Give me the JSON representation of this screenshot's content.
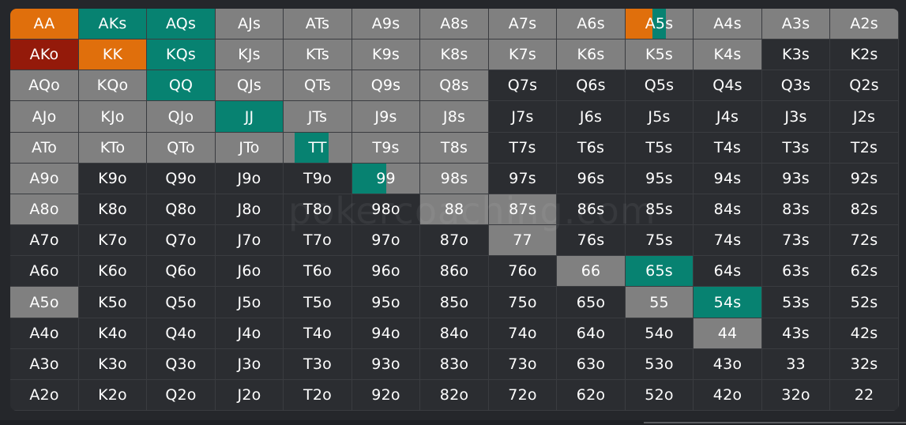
{
  "colors": {
    "fold": "#2b2d31",
    "neutral": "#808080",
    "teal": "#078271",
    "orange": "#e06f0c",
    "red": "#941a0a"
  },
  "watermark": "pokercoaching.com",
  "grid": {
    "rows": [
      [
        [
          "AA",
          "orange",
          1
        ],
        [
          "AKs",
          "teal",
          1
        ],
        [
          "AQs",
          "teal",
          1
        ],
        [
          "AJs",
          "neutral",
          1
        ],
        [
          "ATs",
          "neutral",
          1
        ],
        [
          "A9s",
          "neutral",
          1
        ],
        [
          "A8s",
          "neutral",
          1
        ],
        [
          "A7s",
          "neutral",
          1
        ],
        [
          "A6s",
          "neutral",
          1
        ],
        [
          "A5s",
          "orange",
          0.4,
          "teal",
          0.2,
          "neutral",
          0.4
        ],
        [
          "A4s",
          "neutral",
          1
        ],
        [
          "A3s",
          "neutral",
          1
        ],
        [
          "A2s",
          "neutral",
          1
        ]
      ],
      [
        [
          "AKo",
          "red",
          1
        ],
        [
          "KK",
          "orange",
          1
        ],
        [
          "KQs",
          "teal",
          1
        ],
        [
          "KJs",
          "neutral",
          1
        ],
        [
          "KTs",
          "neutral",
          1
        ],
        [
          "K9s",
          "neutral",
          1
        ],
        [
          "K8s",
          "neutral",
          1
        ],
        [
          "K7s",
          "neutral",
          1
        ],
        [
          "K6s",
          "neutral",
          1
        ],
        [
          "K5s",
          "neutral",
          1
        ],
        [
          "K4s",
          "neutral",
          1
        ],
        [
          "K3s",
          "fold",
          1
        ],
        [
          "K2s",
          "fold",
          1
        ]
      ],
      [
        [
          "AQo",
          "neutral",
          1
        ],
        [
          "KQo",
          "neutral",
          1
        ],
        [
          "QQ",
          "teal",
          1
        ],
        [
          "QJs",
          "neutral",
          1
        ],
        [
          "QTs",
          "neutral",
          1
        ],
        [
          "Q9s",
          "neutral",
          1
        ],
        [
          "Q8s",
          "neutral",
          1
        ],
        [
          "Q7s",
          "fold",
          1
        ],
        [
          "Q6s",
          "fold",
          1
        ],
        [
          "Q5s",
          "fold",
          1
        ],
        [
          "Q4s",
          "fold",
          1
        ],
        [
          "Q3s",
          "fold",
          1
        ],
        [
          "Q2s",
          "fold",
          1
        ]
      ],
      [
        [
          "AJo",
          "neutral",
          1
        ],
        [
          "KJo",
          "neutral",
          1
        ],
        [
          "QJo",
          "neutral",
          1
        ],
        [
          "JJ",
          "teal",
          1
        ],
        [
          "JTs",
          "neutral",
          1
        ],
        [
          "J9s",
          "neutral",
          1
        ],
        [
          "J8s",
          "neutral",
          1
        ],
        [
          "J7s",
          "fold",
          1
        ],
        [
          "J6s",
          "fold",
          1
        ],
        [
          "J5s",
          "fold",
          1
        ],
        [
          "J4s",
          "fold",
          1
        ],
        [
          "J3s",
          "fold",
          1
        ],
        [
          "J2s",
          "fold",
          1
        ]
      ],
      [
        [
          "ATo",
          "neutral",
          1
        ],
        [
          "KTo",
          "neutral",
          1
        ],
        [
          "QTo",
          "neutral",
          1
        ],
        [
          "JTo",
          "neutral",
          1
        ],
        [
          "TT",
          "neutral",
          0.16,
          "teal",
          0.5,
          "neutral",
          0.34
        ],
        [
          "T9s",
          "neutral",
          1
        ],
        [
          "T8s",
          "neutral",
          1
        ],
        [
          "T7s",
          "fold",
          1
        ],
        [
          "T6s",
          "fold",
          1
        ],
        [
          "T5s",
          "fold",
          1
        ],
        [
          "T4s",
          "fold",
          1
        ],
        [
          "T3s",
          "fold",
          1
        ],
        [
          "T2s",
          "fold",
          1
        ]
      ],
      [
        [
          "A9o",
          "neutral",
          1
        ],
        [
          "K9o",
          "fold",
          1
        ],
        [
          "Q9o",
          "fold",
          1
        ],
        [
          "J9o",
          "fold",
          1
        ],
        [
          "T9o",
          "fold",
          1
        ],
        [
          "99",
          "teal",
          0.5,
          "neutral",
          0.5
        ],
        [
          "98s",
          "neutral",
          1
        ],
        [
          "97s",
          "fold",
          1
        ],
        [
          "96s",
          "fold",
          1
        ],
        [
          "95s",
          "fold",
          1
        ],
        [
          "94s",
          "fold",
          1
        ],
        [
          "93s",
          "fold",
          1
        ],
        [
          "92s",
          "fold",
          1
        ]
      ],
      [
        [
          "A8o",
          "neutral",
          1
        ],
        [
          "K8o",
          "fold",
          1
        ],
        [
          "Q8o",
          "fold",
          1
        ],
        [
          "J8o",
          "fold",
          1
        ],
        [
          "T8o",
          "fold",
          1
        ],
        [
          "98o",
          "fold",
          1
        ],
        [
          "88",
          "neutral",
          1
        ],
        [
          "87s",
          "neutral",
          1
        ],
        [
          "86s",
          "fold",
          1
        ],
        [
          "85s",
          "fold",
          1
        ],
        [
          "84s",
          "fold",
          1
        ],
        [
          "83s",
          "fold",
          1
        ],
        [
          "82s",
          "fold",
          1
        ]
      ],
      [
        [
          "A7o",
          "fold",
          1
        ],
        [
          "K7o",
          "fold",
          1
        ],
        [
          "Q7o",
          "fold",
          1
        ],
        [
          "J7o",
          "fold",
          1
        ],
        [
          "T7o",
          "fold",
          1
        ],
        [
          "97o",
          "fold",
          1
        ],
        [
          "87o",
          "fold",
          1
        ],
        [
          "77",
          "neutral",
          1
        ],
        [
          "76s",
          "fold",
          1
        ],
        [
          "75s",
          "fold",
          1
        ],
        [
          "74s",
          "fold",
          1
        ],
        [
          "73s",
          "fold",
          1
        ],
        [
          "72s",
          "fold",
          1
        ]
      ],
      [
        [
          "A6o",
          "fold",
          1
        ],
        [
          "K6o",
          "fold",
          1
        ],
        [
          "Q6o",
          "fold",
          1
        ],
        [
          "J6o",
          "fold",
          1
        ],
        [
          "T6o",
          "fold",
          1
        ],
        [
          "96o",
          "fold",
          1
        ],
        [
          "86o",
          "fold",
          1
        ],
        [
          "76o",
          "fold",
          1
        ],
        [
          "66",
          "neutral",
          1
        ],
        [
          "65s",
          "teal",
          1
        ],
        [
          "64s",
          "fold",
          1
        ],
        [
          "63s",
          "fold",
          1
        ],
        [
          "62s",
          "fold",
          1
        ]
      ],
      [
        [
          "A5o",
          "neutral",
          1
        ],
        [
          "K5o",
          "fold",
          1
        ],
        [
          "Q5o",
          "fold",
          1
        ],
        [
          "J5o",
          "fold",
          1
        ],
        [
          "T5o",
          "fold",
          1
        ],
        [
          "95o",
          "fold",
          1
        ],
        [
          "85o",
          "fold",
          1
        ],
        [
          "75o",
          "fold",
          1
        ],
        [
          "65o",
          "fold",
          1
        ],
        [
          "55",
          "neutral",
          1
        ],
        [
          "54s",
          "teal",
          1
        ],
        [
          "53s",
          "fold",
          1
        ],
        [
          "52s",
          "fold",
          1
        ]
      ],
      [
        [
          "A4o",
          "fold",
          1
        ],
        [
          "K4o",
          "fold",
          1
        ],
        [
          "Q4o",
          "fold",
          1
        ],
        [
          "J4o",
          "fold",
          1
        ],
        [
          "T4o",
          "fold",
          1
        ],
        [
          "94o",
          "fold",
          1
        ],
        [
          "84o",
          "fold",
          1
        ],
        [
          "74o",
          "fold",
          1
        ],
        [
          "64o",
          "fold",
          1
        ],
        [
          "54o",
          "fold",
          1
        ],
        [
          "44",
          "neutral",
          1
        ],
        [
          "43s",
          "fold",
          1
        ],
        [
          "42s",
          "fold",
          1
        ]
      ],
      [
        [
          "A3o",
          "fold",
          1
        ],
        [
          "K3o",
          "fold",
          1
        ],
        [
          "Q3o",
          "fold",
          1
        ],
        [
          "J3o",
          "fold",
          1
        ],
        [
          "T3o",
          "fold",
          1
        ],
        [
          "93o",
          "fold",
          1
        ],
        [
          "83o",
          "fold",
          1
        ],
        [
          "73o",
          "fold",
          1
        ],
        [
          "63o",
          "fold",
          1
        ],
        [
          "53o",
          "fold",
          1
        ],
        [
          "43o",
          "fold",
          1
        ],
        [
          "33",
          "fold",
          1
        ],
        [
          "32s",
          "fold",
          1
        ]
      ],
      [
        [
          "A2o",
          "fold",
          1
        ],
        [
          "K2o",
          "fold",
          1
        ],
        [
          "Q2o",
          "fold",
          1
        ],
        [
          "J2o",
          "fold",
          1
        ],
        [
          "T2o",
          "fold",
          1
        ],
        [
          "92o",
          "fold",
          1
        ],
        [
          "82o",
          "fold",
          1
        ],
        [
          "72o",
          "fold",
          1
        ],
        [
          "62o",
          "fold",
          1
        ],
        [
          "52o",
          "fold",
          1
        ],
        [
          "42o",
          "fold",
          1
        ],
        [
          "32o",
          "fold",
          1
        ],
        [
          "22",
          "fold",
          1
        ]
      ]
    ]
  }
}
